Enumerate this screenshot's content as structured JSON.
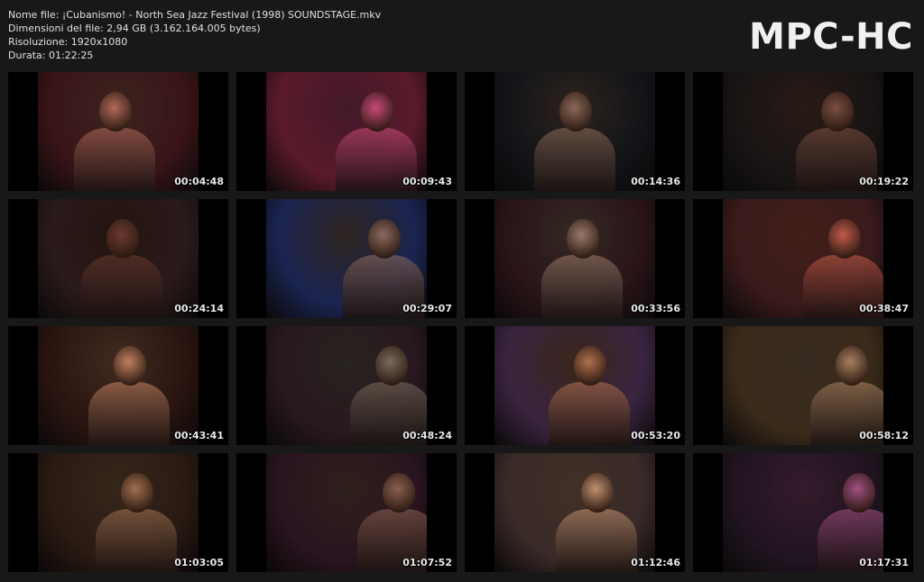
{
  "info": {
    "file_name": "Nome file: ¡Cubanismo! - North Sea Jazz Festival (1998) SOUNDSTAGE.mkv",
    "file_size": "Dimensioni del file: 2,94 GB (3.162.164.005 bytes)",
    "resolution": "Risoluzione: 1920x1080",
    "duration": "Durata: 01:22:25"
  },
  "brand": "MPC-HC",
  "thumbnails": [
    {
      "time": "00:04:48",
      "bg": "#3a1418",
      "accent": "#b06a5a"
    },
    {
      "time": "00:09:43",
      "bg": "#5a1a2a",
      "accent": "#c84a7a"
    },
    {
      "time": "00:14:36",
      "bg": "#121418",
      "accent": "#8a6a58"
    },
    {
      "time": "00:19:22",
      "bg": "#181414",
      "accent": "#7a5040"
    },
    {
      "time": "00:24:14",
      "bg": "#2a1a1a",
      "accent": "#6a3a30"
    },
    {
      "time": "00:29:07",
      "bg": "#1a2450",
      "accent": "#8a6a60"
    },
    {
      "time": "00:33:56",
      "bg": "#2a1418",
      "accent": "#9a7a6a"
    },
    {
      "time": "00:38:47",
      "bg": "#3a1a1a",
      "accent": "#c05a4a"
    },
    {
      "time": "00:43:41",
      "bg": "#2a1410",
      "accent": "#c08060"
    },
    {
      "time": "00:48:24",
      "bg": "#281820",
      "accent": "#7a6a5a"
    },
    {
      "time": "00:53:20",
      "bg": "#3a2440",
      "accent": "#b07050"
    },
    {
      "time": "00:58:12",
      "bg": "#3a2a1a",
      "accent": "#a88060"
    },
    {
      "time": "01:03:05",
      "bg": "#2a1a12",
      "accent": "#a07050"
    },
    {
      "time": "01:07:52",
      "bg": "#2a1420",
      "accent": "#8a6050"
    },
    {
      "time": "01:12:46",
      "bg": "#3a2a28",
      "accent": "#c09070"
    },
    {
      "time": "01:17:31",
      "bg": "#201420",
      "accent": "#a05080"
    }
  ]
}
